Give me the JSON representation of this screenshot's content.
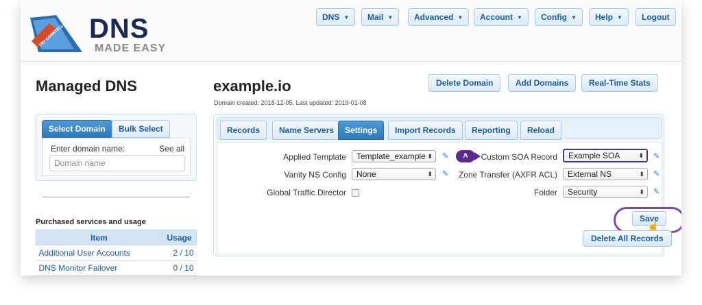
{
  "brand": {
    "logo_text": "DNS",
    "logo_sub": "MADE EASY",
    "ribbon": "TRY CONSTELLIX"
  },
  "nav": {
    "items": [
      {
        "label": "DNS",
        "has_caret": true
      },
      {
        "label": "Mail",
        "has_caret": true
      },
      {
        "label": "Advanced",
        "has_caret": true
      },
      {
        "label": "Account",
        "has_caret": true
      },
      {
        "label": "Config",
        "has_caret": true
      },
      {
        "label": "Help",
        "has_caret": true
      },
      {
        "label": "Logout",
        "has_caret": false
      }
    ]
  },
  "page": {
    "title": "Managed DNS",
    "domain": "example.io",
    "domain_meta": "Domain created: 2018-12-05, Last updated: 2019-01-08"
  },
  "actions": {
    "delete_domain": "Delete Domain",
    "add_domains": "Add Domains",
    "realtime_stats": "Real-Time Stats"
  },
  "left_panel": {
    "tab_select": "Select Domain",
    "tab_bulk": "Bulk Select",
    "enter_label": "Enter domain name:",
    "see_all": "See all",
    "input_placeholder": "Domain name"
  },
  "usage": {
    "heading": "Purchased services and usage",
    "columns": [
      "Item",
      "Usage"
    ],
    "rows": [
      {
        "item": "Additional User Accounts",
        "usage": "2 / 10"
      },
      {
        "item": "DNS Monitor Failover",
        "usage": "0 / 10"
      }
    ]
  },
  "tabs": [
    {
      "label": "Records",
      "active": false
    },
    {
      "label": "Name Servers",
      "active": false
    },
    {
      "label": "Settings",
      "active": true
    },
    {
      "label": "Import Records",
      "active": false
    },
    {
      "label": "Reporting",
      "active": false
    },
    {
      "label": "Reload",
      "active": false
    }
  ],
  "settings": {
    "applied_template_label": "Applied Template",
    "applied_template_value": "Template_example",
    "vanity_ns_label": "Vanity NS Config",
    "vanity_ns_value": "None",
    "gtd_label": "Global Traffic Director",
    "gtd_checked": false,
    "soa_badge": "A",
    "soa_label": "Custom SOA Record",
    "soa_value": "Example SOA",
    "zone_transfer_label": "Zone Transfer (AXFR ACL)",
    "zone_transfer_value": "External NS",
    "folder_label": "Folder",
    "folder_value": "Security",
    "save": "Save",
    "delete_all": "Delete All Records"
  },
  "colors": {
    "accent": "#1d5aa0",
    "active_tab": "#2e78bd",
    "highlight_ring": "#7b4aa2",
    "badge": "#5b2a8a"
  }
}
